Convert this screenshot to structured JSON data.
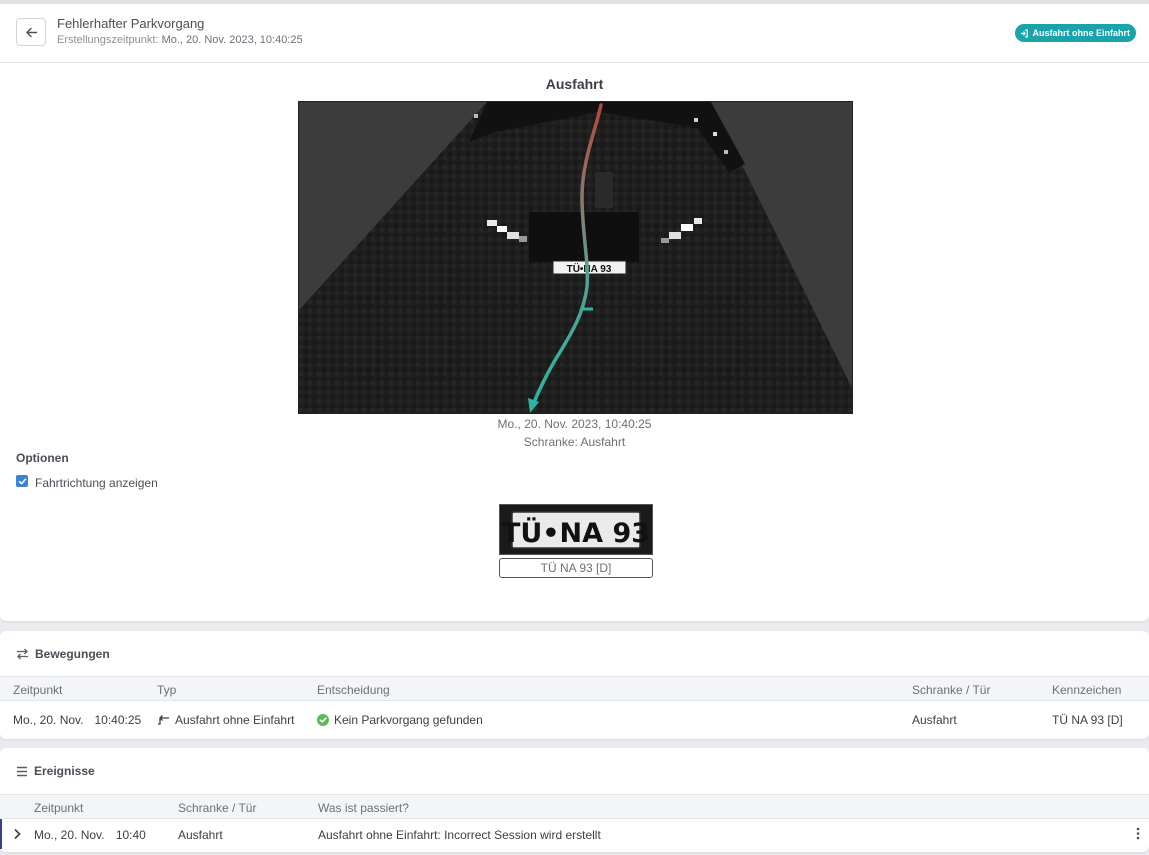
{
  "header": {
    "title": "Fehlerhafter Parkvorgang",
    "created_label": "Erstellungszeitpunkt:",
    "created_value": "Mo., 20. Nov. 2023, 10:40:25",
    "action_button": "Ausfahrt ohne Einfahrt"
  },
  "capture": {
    "title": "Ausfahrt",
    "plate_in_image": "TÜ•NA 93",
    "time": "Mo., 20. Nov. 2023, 10:40:25",
    "gate": "Schranke: Ausfahrt"
  },
  "options": {
    "label": "Optionen",
    "show_direction_label": "Fahrtrichtung anzeigen",
    "show_direction_checked": true
  },
  "plate": {
    "crop_text": "TÜ•NA 93",
    "recognized": "TÜ NA 93 [D]"
  },
  "movements": {
    "title": "Bewegungen",
    "columns": [
      "Zeitpunkt",
      "Typ",
      "Entscheidung",
      "Schranke / Tür",
      "Kennzeichen"
    ],
    "rows": [
      {
        "date": "Mo., 20. Nov.",
        "time": "10:40:25",
        "type": "Ausfahrt ohne Einfahrt",
        "decision": "Kein Parkvorgang gefunden",
        "gate": "Ausfahrt",
        "plate": "TÜ NA 93 [D]"
      }
    ]
  },
  "events": {
    "title": "Ereignisse",
    "columns": [
      "Zeitpunkt",
      "Schranke / Tür",
      "Was ist passiert?"
    ],
    "rows": [
      {
        "date": "Mo., 20. Nov.",
        "time": "10:40",
        "gate": "Ausfahrt",
        "what": "Ausfahrt ohne Einfahrt: Incorrect Session wird erstellt"
      }
    ]
  },
  "colors": {
    "accent_teal": "#1aa3a8",
    "checkbox_blue": "#3b82d6",
    "success_green": "#5cb85c",
    "track_start": "#b5483f",
    "track_end": "#2bb5a3"
  }
}
